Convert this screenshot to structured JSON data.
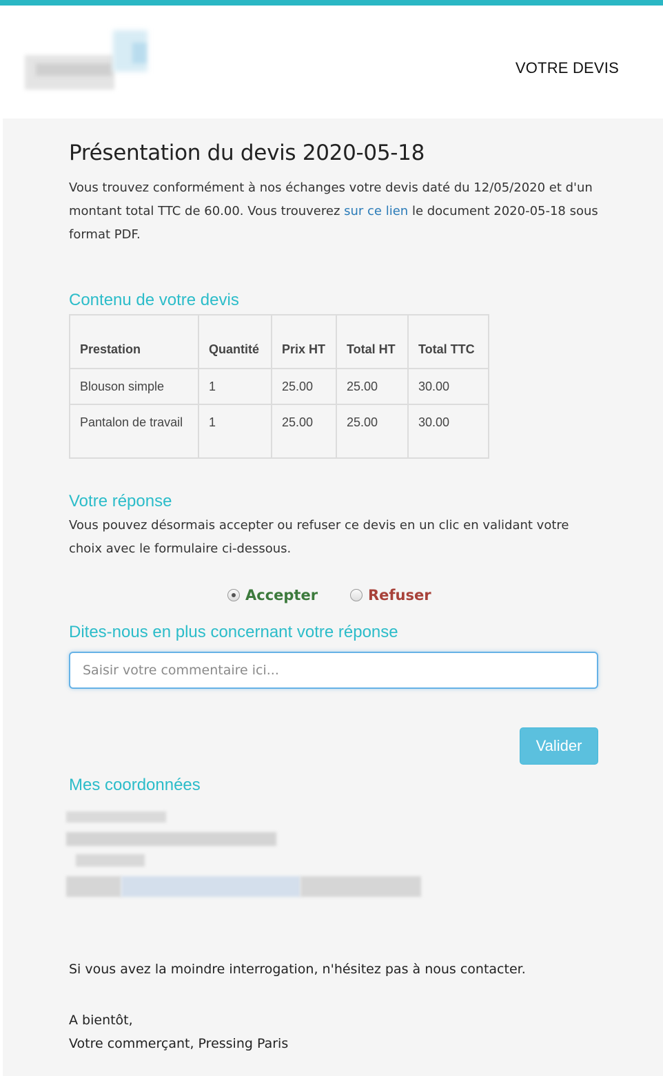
{
  "header": {
    "title": "VOTRE DEVIS"
  },
  "main": {
    "title": "Présentation du devis 2020-05-18",
    "intro_before_link": "Vous trouvez conformément à nos échanges votre devis daté du 12/05/2020 et d'un montant total TTC de 60.00. Vous trouverez ",
    "intro_link": "sur ce lien",
    "intro_after_link": " le document 2020-05-18 sous format PDF."
  },
  "contenu": {
    "title": "Contenu de votre devis",
    "columns": [
      "Prestation",
      "Quantité",
      "Prix HT",
      "Total HT",
      "Total TTC"
    ],
    "rows": [
      [
        "Blouson simple",
        "1",
        "25.00",
        "25.00",
        "30.00"
      ],
      [
        "Pantalon de travail",
        "1",
        "25.00",
        "25.00",
        "30.00"
      ]
    ]
  },
  "reponse": {
    "title": "Votre réponse",
    "text": "Vous pouvez désormais accepter ou refuser ce devis en un clic en validant votre choix avec le formulaire ci-dessous.",
    "accept_label": "Accepter",
    "refuse_label": "Refuser",
    "selected": "Accepter"
  },
  "comment": {
    "title": "Dites-nous en plus concernant votre réponse",
    "placeholder": "Saisir votre commentaire ici...",
    "value": ""
  },
  "submit_label": "Valider",
  "coordonnees": {
    "title": "Mes coordonnées"
  },
  "closing": "Si vous avez la moindre interrogation, n'hésitez pas à nous contacter.",
  "signoff": {
    "line1": "A bientôt,",
    "line2": "Votre commerçant, Pressing Paris"
  },
  "colors": {
    "accent": "#2bbcc9",
    "accept": "#3c7a3c",
    "refuse": "#a8423a",
    "button": "#5bc0de",
    "link": "#2a7bb8"
  }
}
